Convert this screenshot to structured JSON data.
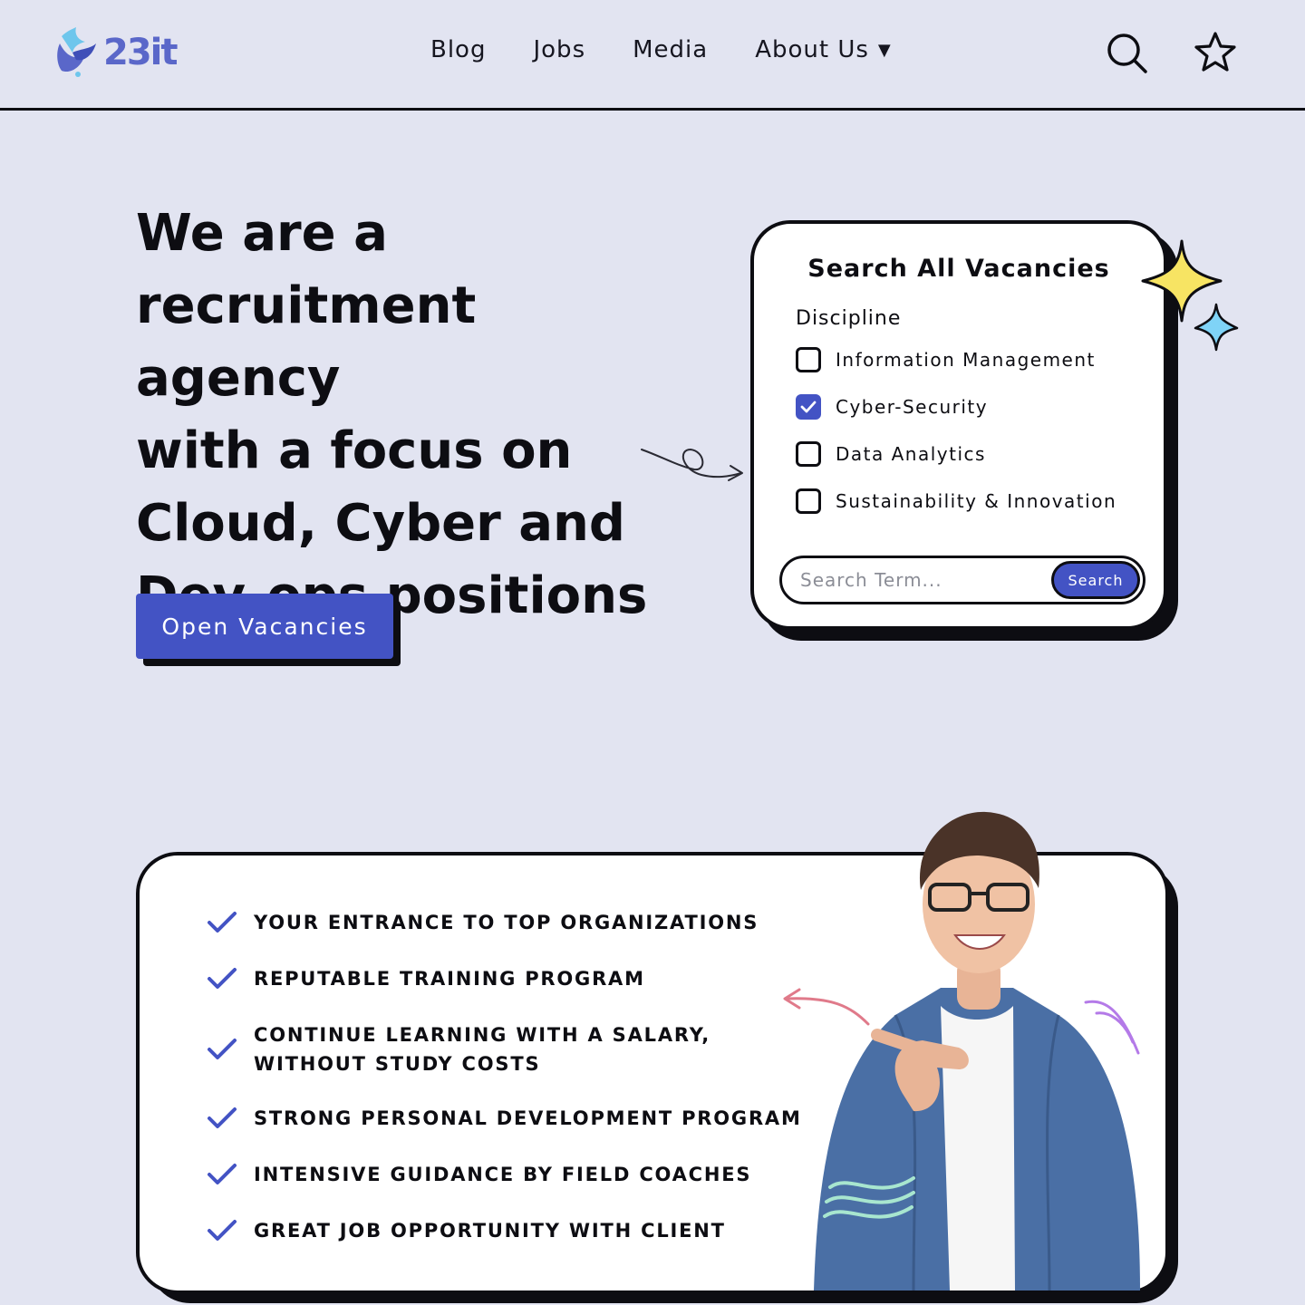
{
  "header": {
    "logo_text": "23it",
    "nav": [
      {
        "label": "Blog"
      },
      {
        "label": "Jobs"
      },
      {
        "label": "Media"
      },
      {
        "label": "About Us",
        "has_dropdown": true
      }
    ],
    "icons": [
      "search-icon",
      "star-icon"
    ]
  },
  "hero": {
    "title_lines": [
      "We are a",
      "recruitment agency",
      "with a focus on",
      "Cloud, Cyber and",
      "Dev-ops positions"
    ],
    "cta_label": "Open Vacancies"
  },
  "search_card": {
    "title": "Search All Vacancies",
    "discipline_label": "Discipline",
    "options": [
      {
        "label": "Information Management",
        "checked": false
      },
      {
        "label": "Cyber-Security",
        "checked": true
      },
      {
        "label": "Data Analytics",
        "checked": false
      },
      {
        "label": "Sustainability & Innovation",
        "checked": false
      }
    ],
    "search_placeholder": "Search Term...",
    "search_value": "",
    "search_button": "Search"
  },
  "benefits": {
    "items": [
      "YOUR ENTRANCE TO TOP ORGANIZATIONS",
      "REPUTABLE TRAINING PROGRAM",
      "CONTINUE LEARNING WITH A SALARY,\nWITHOUT STUDY COSTS",
      "STRONG PERSONAL DEVELOPMENT PROGRAM",
      "INTENSIVE GUIDANCE BY FIELD COACHES",
      "GREAT JOB OPPORTUNITY WITH CLIENT"
    ]
  },
  "colors": {
    "background": "#e2e4f1",
    "accent": "#4353c4",
    "ink": "#0d0d12",
    "logo": "#5a67c9",
    "sparkle_yellow": "#f7e463",
    "sparkle_blue": "#7fd3f7"
  }
}
